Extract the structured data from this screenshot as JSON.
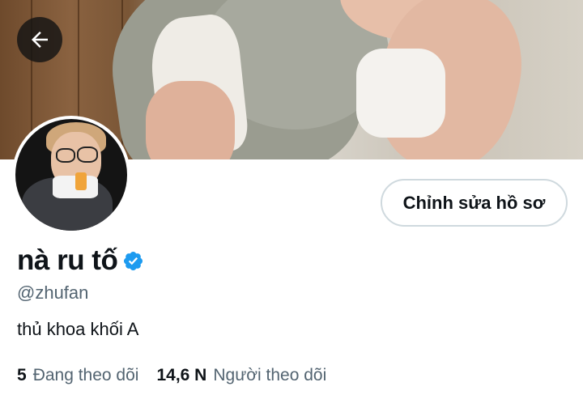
{
  "header": {
    "back_icon": "arrow-left-icon"
  },
  "profile": {
    "display_name": "nà ru tố",
    "verified_icon": "verified-badge-icon",
    "handle": "@zhufan",
    "bio": "thủ khoa khối A",
    "edit_button_label": "Chỉnh sửa hồ sơ",
    "following_count": "5",
    "following_label": "Đang theo dõi",
    "followers_count": "14,6 N",
    "followers_label": "Người theo dõi"
  },
  "colors": {
    "verified_blue": "#1d9bf0",
    "secondary_text": "#536471",
    "primary_text": "#0f1419",
    "button_border": "#cfd9de"
  }
}
